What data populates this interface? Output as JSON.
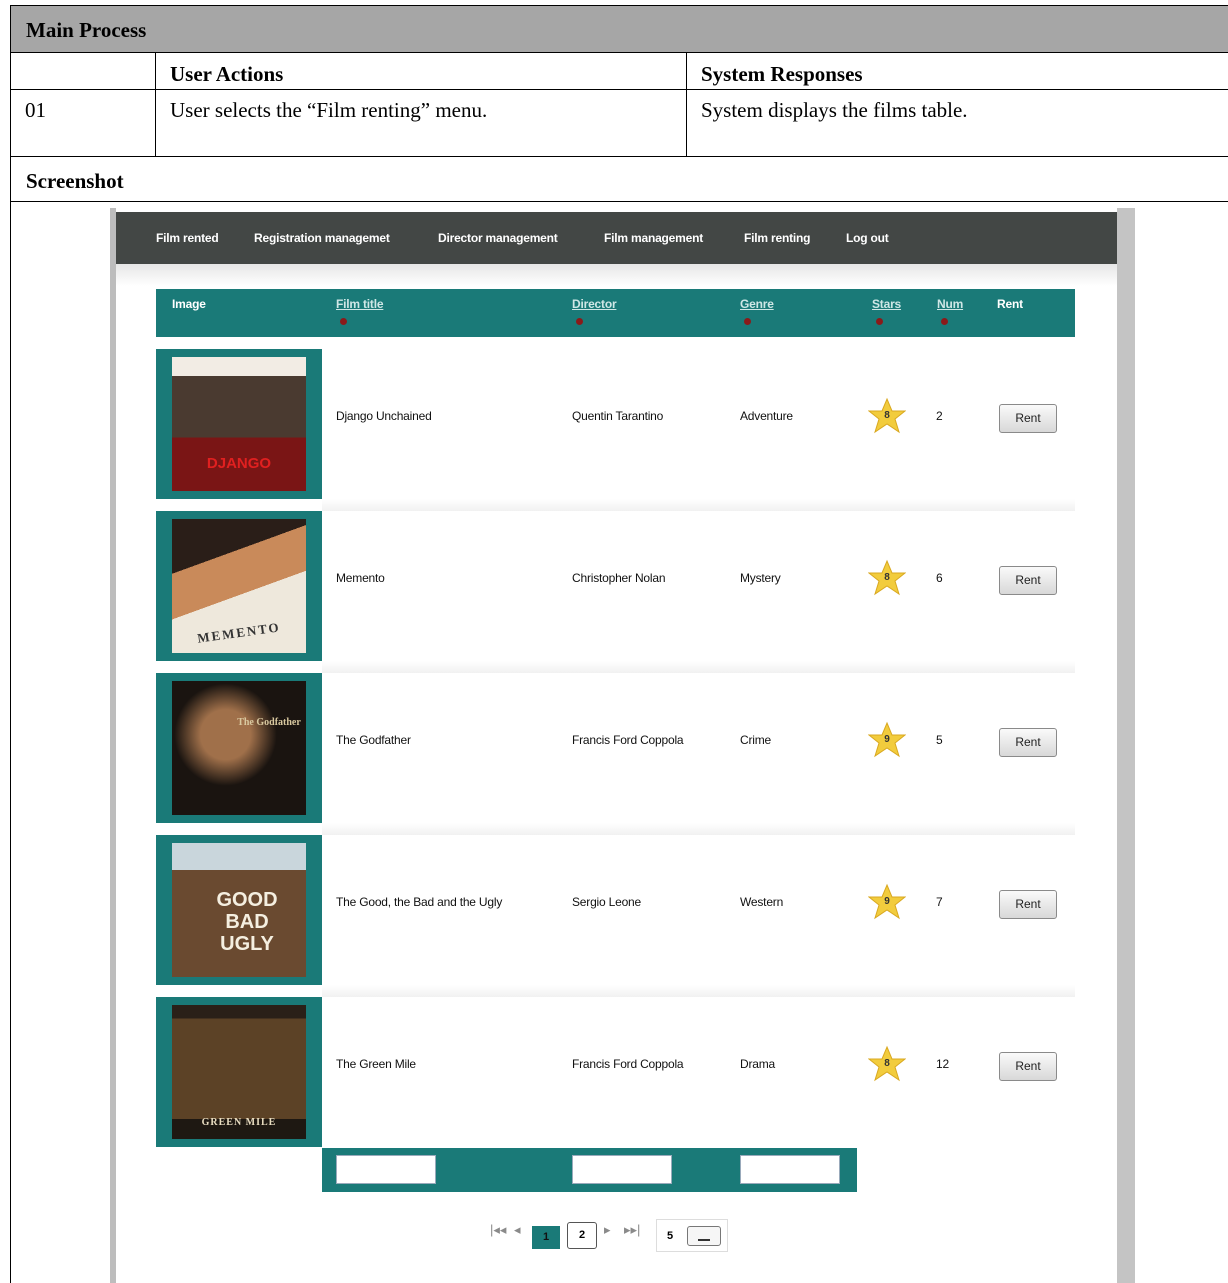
{
  "doc": {
    "main_process": "Main Process",
    "header": {
      "step": "",
      "user_actions": "User Actions",
      "system_responses": "System Responses"
    },
    "step": {
      "number": "01",
      "user_action": "User selects the “Film renting” menu.",
      "system_response": "System displays the films table."
    },
    "screenshot_label": "Screenshot"
  },
  "app": {
    "nav": [
      "Film rented",
      "Registration managemet",
      "Director management",
      "Film management",
      "Film renting",
      "Log out"
    ],
    "columns": {
      "image": "Image",
      "title": "Film title",
      "director": "Director",
      "genre": "Genre",
      "stars": "Stars",
      "num": "Num",
      "rent": "Rent"
    },
    "films": [
      {
        "title": "Django Unchained",
        "director": "Quentin Tarantino",
        "genre": "Adventure",
        "stars": "8",
        "num": "2",
        "rent": "Rent",
        "poster": "DJANGO"
      },
      {
        "title": "Memento",
        "director": "Christopher Nolan",
        "genre": "Mystery",
        "stars": "8",
        "num": "6",
        "rent": "Rent",
        "poster": "MEMENTO"
      },
      {
        "title": "The Godfather",
        "director": "Francis Ford Coppola",
        "genre": "Crime",
        "stars": "9",
        "num": "5",
        "rent": "Rent",
        "poster": "The Godfather"
      },
      {
        "title": "The Good, the Bad and the Ugly",
        "director": "Sergio Leone",
        "genre": "Western",
        "stars": "9",
        "num": "7",
        "rent": "Rent",
        "poster": "GOOD BAD UGLY"
      },
      {
        "title": "The Green Mile",
        "director": "Francis Ford Coppola",
        "genre": "Drama",
        "stars": "8",
        "num": "12",
        "rent": "Rent",
        "poster": "GREEN MILE"
      }
    ],
    "pager": {
      "current": "1",
      "next": "2",
      "page_size": "5"
    },
    "colors": {
      "teal": "#1a7a78",
      "nav": "#434745",
      "star": "#f2cc3d"
    }
  }
}
